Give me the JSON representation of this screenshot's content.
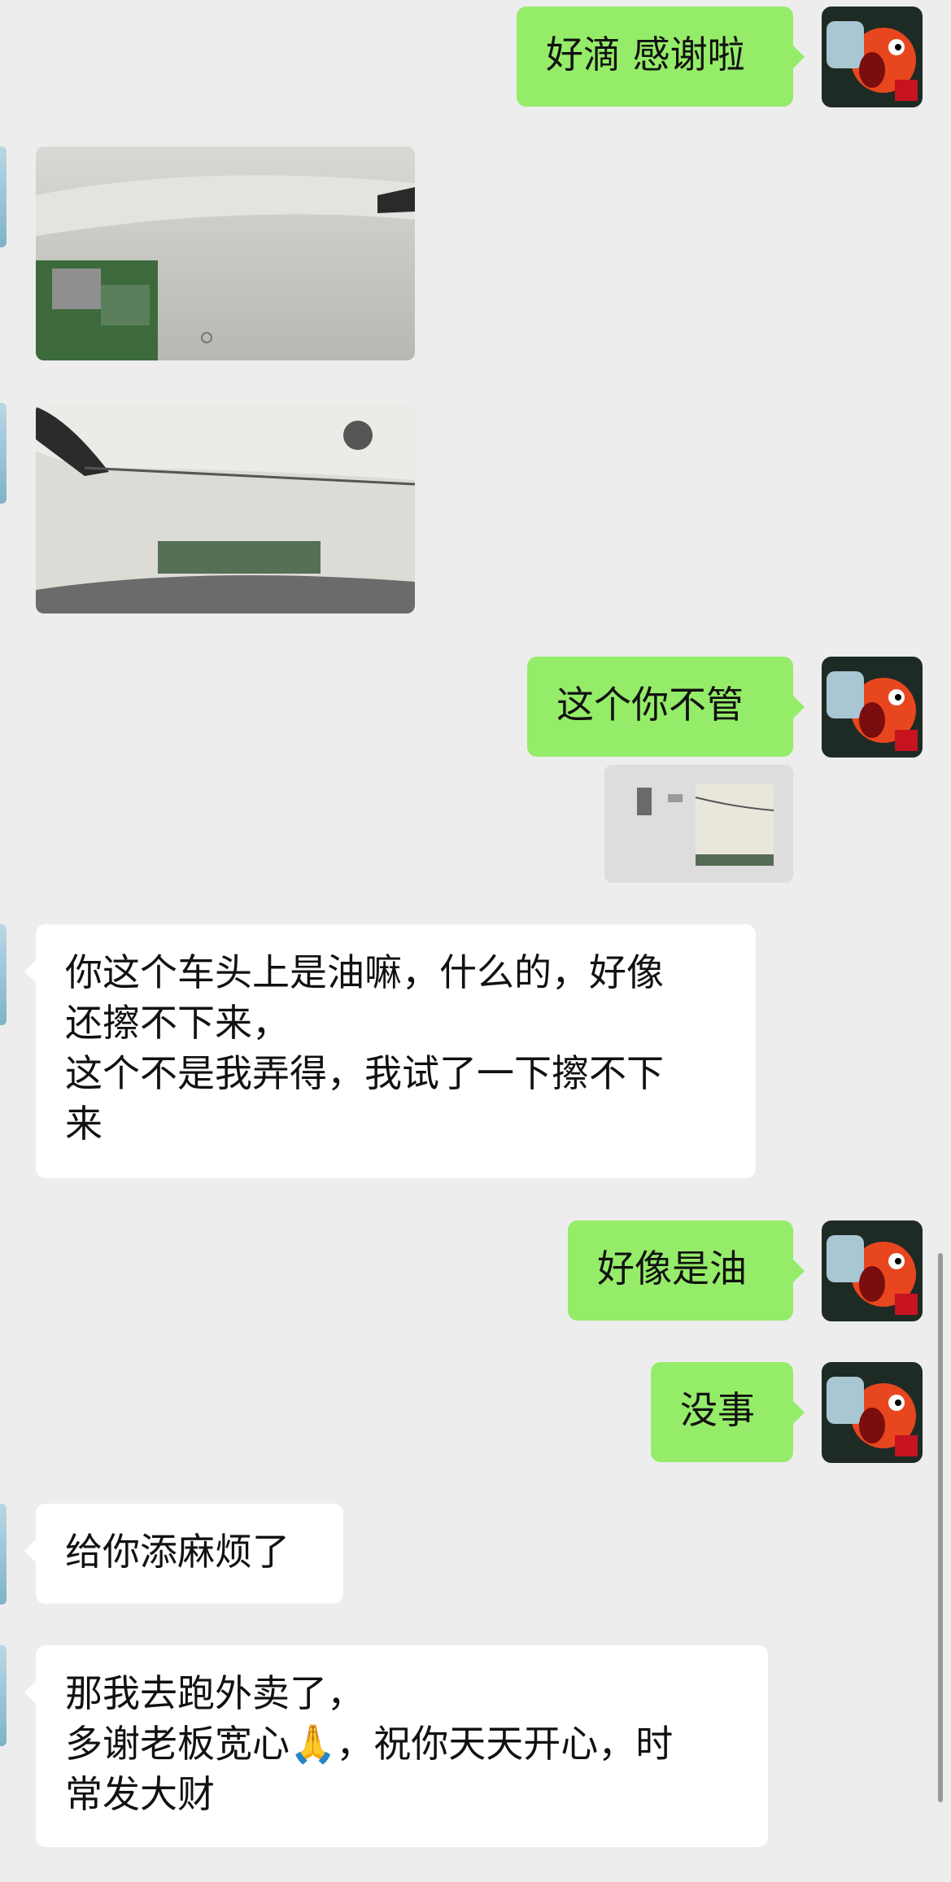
{
  "conversation": {
    "messages": [
      {
        "id": "m1",
        "side": "me",
        "text": "好滴 感谢啦"
      },
      {
        "id": "m2",
        "side": "them",
        "type": "image",
        "image_icon": "photo-car-side-icon"
      },
      {
        "id": "m3",
        "side": "them",
        "type": "image",
        "image_icon": "photo-car-front-icon"
      },
      {
        "id": "m4",
        "side": "me",
        "text": "这个你不管"
      },
      {
        "id": "m4q",
        "side": "me",
        "type": "quoted-image",
        "image_icon": "quoted-photo-thumbnail-icon"
      },
      {
        "id": "m5",
        "side": "them",
        "text": "你这个车头上是油嘛，什么的，好像\n还擦不下来，\n这个不是我弄得，我试了一下擦不下\n来"
      },
      {
        "id": "m6",
        "side": "me",
        "text": "好像是油"
      },
      {
        "id": "m7",
        "side": "me",
        "text": "没事"
      },
      {
        "id": "m8",
        "side": "them",
        "text": "给你添麻烦了"
      },
      {
        "id": "m9",
        "side": "them",
        "text_line1": "那我去跑外卖了，",
        "text_line2_before_emoji": "多谢老板宽心",
        "emoji": "🙏",
        "text_line2_after_emoji": "，祝你天天开心，时",
        "text_line3": "常发大财"
      }
    ]
  },
  "colors": {
    "me_bubble": "#95ec69",
    "them_bubble": "#ffffff",
    "background": "#ededed"
  },
  "icons": {
    "my_avatar": "cartoon-face-avatar-icon",
    "peer_avatar": "peer-avatar-icon"
  }
}
